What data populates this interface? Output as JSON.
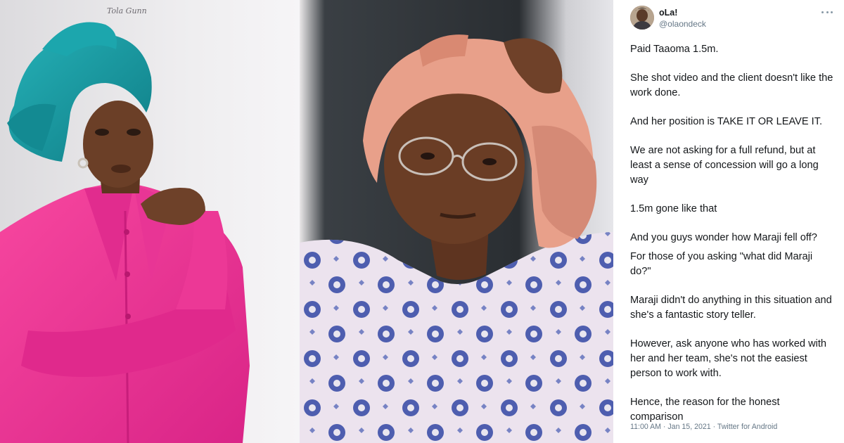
{
  "photo_left": {
    "signature": "Tola Gunn",
    "colors": {
      "background": "#e9e8ea",
      "headwrap": "#1c9aa2",
      "suit": "#f0379a",
      "skin": "#6b3f27"
    }
  },
  "photo_middle": {
    "colors": {
      "background": "#2b2f33",
      "headscarf": "#e8a08a",
      "blouse": "#ece3ee",
      "pattern": "#3c4fa8",
      "skin": "#6a3d25"
    }
  },
  "tweet": {
    "display_name": "oLa!",
    "handle": "@olaondeck",
    "avatar_icon": "avatar-photo",
    "more_icon": "ellipsis-icon",
    "paragraphs": [
      "Paid Taaoma 1.5m.",
      "She shot video and the client doesn't like the work done.",
      "And her position is TAKE IT OR LEAVE IT.",
      "We are not asking for a full refund, but at least a sense of concession will go a long way",
      "1.5m gone like that",
      "And you guys wonder how Maraji fell off?",
      "For those of you asking \"what did Maraji do?\"",
      "Maraji didn't do anything in this situation and she's a fantastic story teller.",
      "However, ask anyone who has worked with her and her team, she's not the easiest person to work with.",
      "Hence, the reason for the honest comparison"
    ],
    "meta": "11:00 AM · Jan 15, 2021 · Twitter for Android",
    "colors": {
      "text": "#14171a",
      "secondary": "#657786"
    }
  }
}
